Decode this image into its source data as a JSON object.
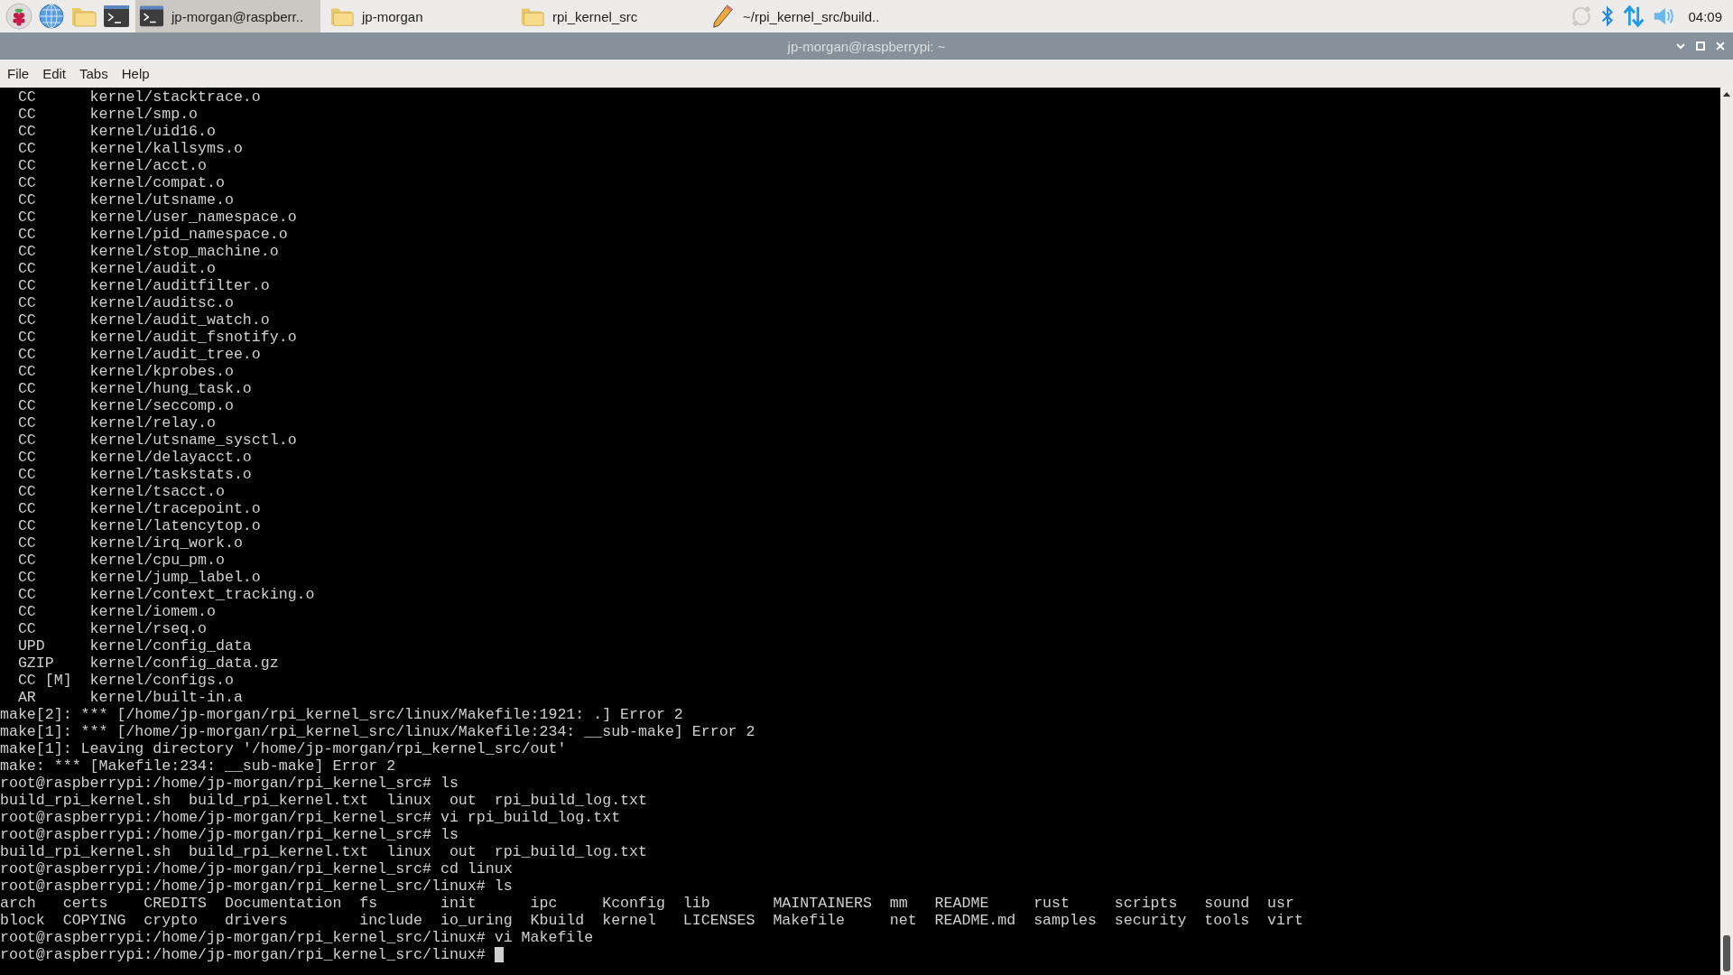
{
  "taskbar": {
    "tasks": [
      {
        "label": "jp-morgan@raspberr..",
        "kind": "terminal",
        "selected": true
      },
      {
        "label": "jp-morgan",
        "kind": "folder",
        "selected": false
      },
      {
        "label": "rpi_kernel_src",
        "kind": "folder",
        "selected": false
      },
      {
        "label": "~/rpi_kernel_src/build..",
        "kind": "editor",
        "selected": false
      }
    ],
    "clock": "04:09"
  },
  "window": {
    "title": "jp-morgan@raspberrypi: ~"
  },
  "menu": [
    "File",
    "Edit",
    "Tabs",
    "Help"
  ],
  "terminal": {
    "lines": [
      "  CC      kernel/stacktrace.o",
      "  CC      kernel/smp.o",
      "  CC      kernel/uid16.o",
      "  CC      kernel/kallsyms.o",
      "  CC      kernel/acct.o",
      "  CC      kernel/compat.o",
      "  CC      kernel/utsname.o",
      "  CC      kernel/user_namespace.o",
      "  CC      kernel/pid_namespace.o",
      "  CC      kernel/stop_machine.o",
      "  CC      kernel/audit.o",
      "  CC      kernel/auditfilter.o",
      "  CC      kernel/auditsc.o",
      "  CC      kernel/audit_watch.o",
      "  CC      kernel/audit_fsnotify.o",
      "  CC      kernel/audit_tree.o",
      "  CC      kernel/kprobes.o",
      "  CC      kernel/hung_task.o",
      "  CC      kernel/seccomp.o",
      "  CC      kernel/relay.o",
      "  CC      kernel/utsname_sysctl.o",
      "  CC      kernel/delayacct.o",
      "  CC      kernel/taskstats.o",
      "  CC      kernel/tsacct.o",
      "  CC      kernel/tracepoint.o",
      "  CC      kernel/latencytop.o",
      "  CC      kernel/irq_work.o",
      "  CC      kernel/cpu_pm.o",
      "  CC      kernel/jump_label.o",
      "  CC      kernel/context_tracking.o",
      "  CC      kernel/iomem.o",
      "  CC      kernel/rseq.o",
      "  UPD     kernel/config_data",
      "  GZIP    kernel/config_data.gz",
      "  CC [M]  kernel/configs.o",
      "  AR      kernel/built-in.a",
      "make[2]: *** [/home/jp-morgan/rpi_kernel_src/linux/Makefile:1921: .] Error 2",
      "make[1]: *** [/home/jp-morgan/rpi_kernel_src/linux/Makefile:234: __sub-make] Error 2",
      "make[1]: Leaving directory '/home/jp-morgan/rpi_kernel_src/out'",
      "make: *** [Makefile:234: __sub-make] Error 2",
      "root@raspberrypi:/home/jp-morgan/rpi_kernel_src# ls",
      "build_rpi_kernel.sh  build_rpi_kernel.txt  linux  out  rpi_build_log.txt",
      "root@raspberrypi:/home/jp-morgan/rpi_kernel_src# vi rpi_build_log.txt",
      "root@raspberrypi:/home/jp-morgan/rpi_kernel_src# ls",
      "build_rpi_kernel.sh  build_rpi_kernel.txt  linux  out  rpi_build_log.txt",
      "root@raspberrypi:/home/jp-morgan/rpi_kernel_src# cd linux",
      "root@raspberrypi:/home/jp-morgan/rpi_kernel_src/linux# ls",
      "arch   certs    CREDITS  Documentation  fs       init      ipc     Kconfig  lib       MAINTAINERS  mm   README     rust     scripts   sound  usr",
      "block  COPYING  crypto   drivers        include  io_uring  Kbuild  kernel   LICENSES  Makefile     net  README.md  samples  security  tools  virt",
      "root@raspberrypi:/home/jp-morgan/rpi_kernel_src/linux# vi Makefile"
    ],
    "prompt": "root@raspberrypi:/home/jp-morgan/rpi_kernel_src/linux# "
  }
}
